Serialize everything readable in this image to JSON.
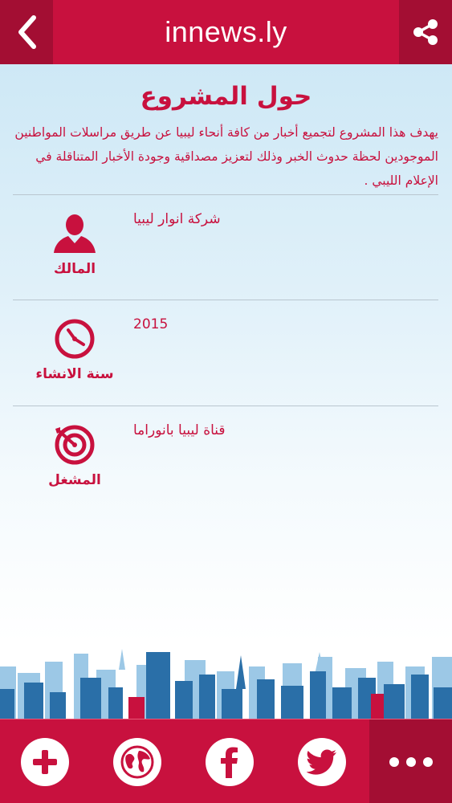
{
  "header": {
    "title": "innews.ly",
    "back_icon": "chevron-left-icon",
    "share_icon": "share-icon"
  },
  "about": {
    "title": "حول المشروع",
    "description": "يهدف هذا المشروع لتجميع أخبار من كافة أنحاء ليبيا عن طريق مراسلات المواطنين الموجودين لحظة حدوث الخبر وذلك لتعزيز مصداقية وجودة الأخبار المتناقلة في الإعلام الليبي ."
  },
  "info": [
    {
      "icon": "person-icon",
      "label": "المالك",
      "value": "شركة انوار ليبيا"
    },
    {
      "icon": "clock-icon",
      "label": "سنة الانشاء",
      "value": "2015"
    },
    {
      "icon": "target-icon",
      "label": "المشغل",
      "value": "قناة ليبيا بانوراما"
    }
  ],
  "bottom_bar": {
    "tabs": [
      {
        "icon": "plus-icon"
      },
      {
        "icon": "globe-icon"
      },
      {
        "icon": "facebook-icon"
      },
      {
        "icon": "twitter-icon"
      },
      {
        "icon": "more-icon"
      }
    ]
  },
  "colors": {
    "brand": "#c8113e",
    "brand_dark": "#a30e33",
    "skyline_dark": "#2a6fa8",
    "skyline_light": "#7fb6dd"
  }
}
